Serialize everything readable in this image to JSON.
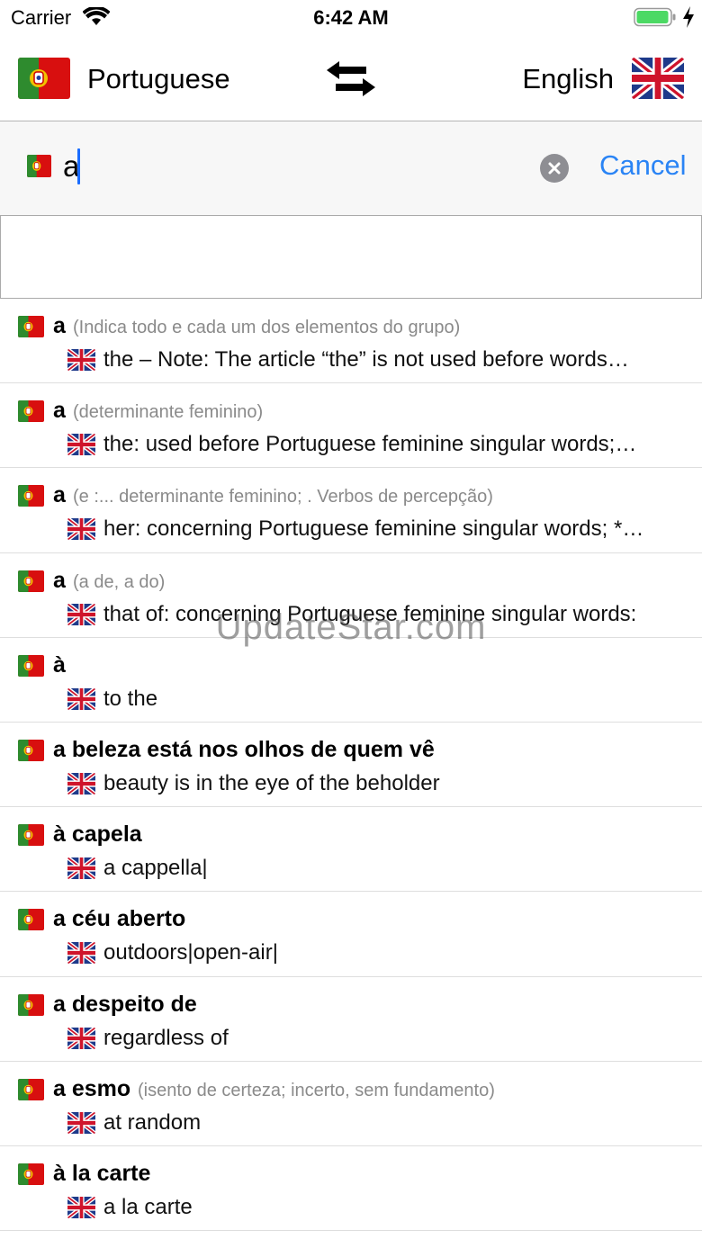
{
  "status_bar": {
    "carrier": "Carrier",
    "time": "6:42 AM",
    "battery_color": "#4cd964"
  },
  "languages": {
    "source": "Portuguese",
    "target": "English"
  },
  "search": {
    "value": "a",
    "cancel_label": "Cancel"
  },
  "results": [
    {
      "term": "a",
      "note": "(Indica todo e cada um dos elementos do grupo)",
      "translation": "the  – Note: The article “the” is not used before words…"
    },
    {
      "term": "a",
      "note": "(determinante feminino)",
      "translation": "the: used before Portuguese feminine singular words;…"
    },
    {
      "term": "a",
      "note": "(e  :... determinante feminino; . Verbos de percepção)",
      "translation": "her: concerning Portuguese feminine singular words; *…"
    },
    {
      "term": "a",
      "note": "(a de, a do)",
      "translation": "that of: concerning Portuguese feminine singular words:"
    },
    {
      "term": "à",
      "note": "",
      "translation": "to the"
    },
    {
      "term": "a beleza está nos olhos de quem vê",
      "note": "",
      "translation": "beauty is in the eye of the beholder"
    },
    {
      "term": "à capela",
      "note": "",
      "translation": "a cappella|"
    },
    {
      "term": "a céu aberto",
      "note": "",
      "translation": "outdoors|open-air|"
    },
    {
      "term": "a despeito de",
      "note": "",
      "translation": "regardless of"
    },
    {
      "term": "a esmo",
      "note": "(isento de certeza; incerto, sem fundamento)",
      "translation": "at random"
    },
    {
      "term": "à la carte",
      "note": "",
      "translation": "a la carte"
    }
  ],
  "watermark": "UpdateStar.com",
  "colors": {
    "accent": "#2a84f5",
    "note_gray": "#8a8a8a"
  }
}
